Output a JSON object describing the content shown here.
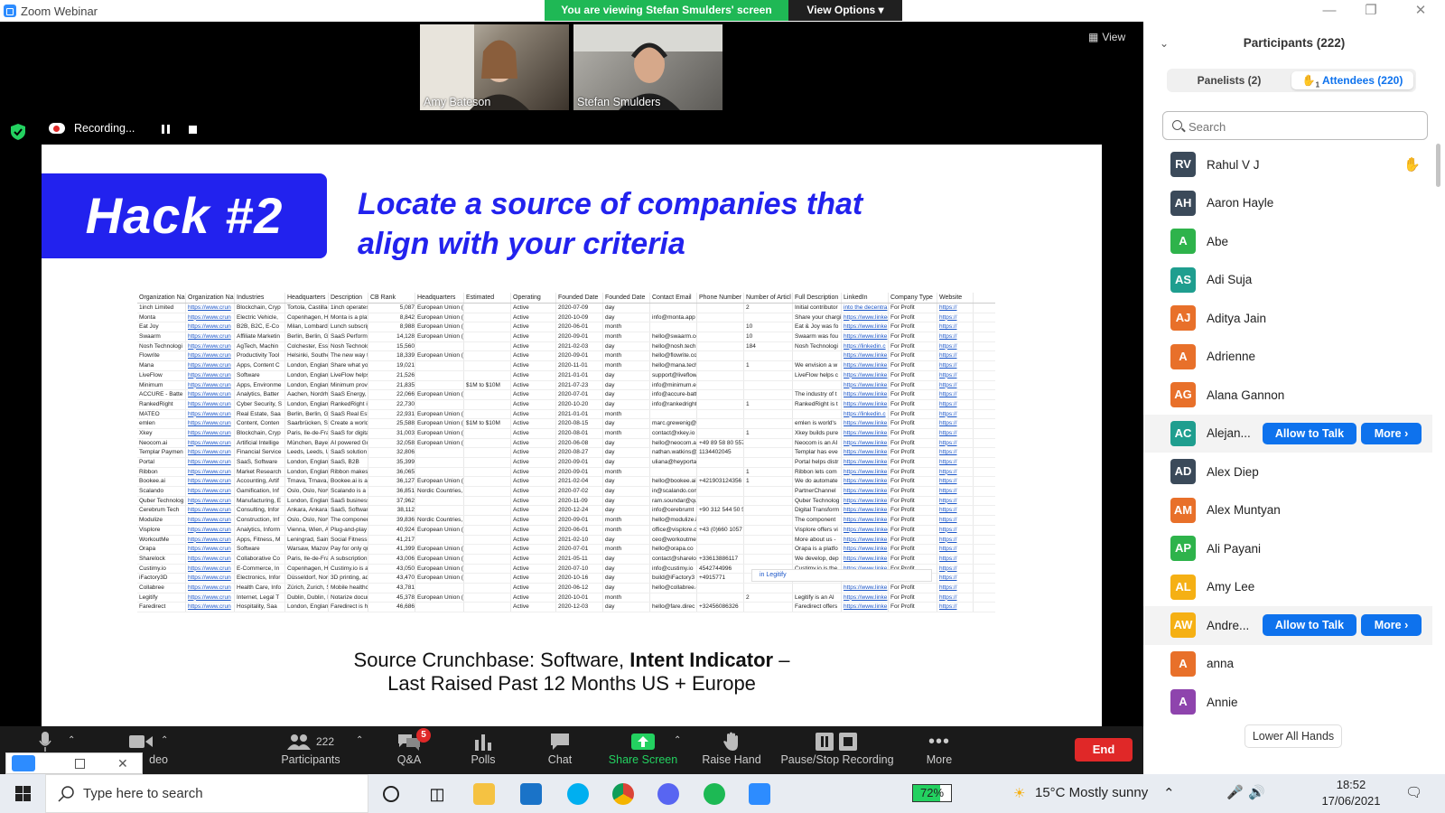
{
  "window": {
    "title": "Zoom Webinar"
  },
  "banner": {
    "viewing": "You are viewing Stefan Smulders' screen",
    "view_options": "View Options"
  },
  "videos": [
    {
      "name": "Amy Bateson"
    },
    {
      "name": "Stefan Smulders"
    }
  ],
  "view_button": "View",
  "recording": {
    "label": "Recording..."
  },
  "slide": {
    "hack_label": "Hack #2",
    "headline_line1": "Locate a source of companies that",
    "headline_line2": "align with your criteria",
    "source_prefix": "Source Crunchbase: Software, ",
    "source_bold": "Intent Indicator",
    "source_suffix": " –",
    "source_line2": "Last Raised Past 12 Months US + Europe"
  },
  "spreadsheet": {
    "headers": [
      "Organization Na",
      "Organization Na",
      "Industries",
      "Headquarters Lo",
      "Description",
      "CB Rank (Comp",
      "Headquarters Re",
      "Estimated Rever",
      "Operating Status",
      "Founded Date",
      "Founded Date P",
      "Contact Email",
      "Phone Number",
      "Number of Articl",
      "Full Description",
      "LinkedIn",
      "Company Type",
      "Website"
    ],
    "rows": [
      [
        "1inch Limited",
        "https://www.crun",
        "Blockchain, Cryp",
        "Tortola, Castilla-",
        "1inch operates a",
        "5,087",
        "European Union (EU)",
        "",
        "Active",
        "2020-07-09",
        "day",
        "",
        "",
        "2",
        "Initial contributor",
        "into the decentra",
        "For Profit",
        "https://"
      ],
      [
        "Monta",
        "https://www.crun",
        "Electric Vehicle,",
        "Copenhagen, He",
        "Monta is a platfo",
        "8,842",
        "European Union (EU), Nordic Cou",
        "",
        "Active",
        "2020-10-09",
        "day",
        "info@monta.app",
        "",
        "",
        "Share your chargi",
        "https://www.linkedin.com/compan",
        "For Profit",
        "https://"
      ],
      [
        "Eat Joy",
        "https://www.crun",
        "B2B, B2C, E-Co",
        "Milan, Lombardi",
        "Lunch subscripti",
        "8,988",
        "European Union (EU)",
        "",
        "Active",
        "2020-06-01",
        "month",
        "",
        "",
        "10",
        "Eat & Joy was fo",
        "https://www.linke",
        "For Profit",
        "https://"
      ],
      [
        "Swaarm",
        "https://www.crun",
        "Affiliate Marketin",
        "Berlin, Berlin, Ge",
        "SaaS Performan",
        "14,128",
        "European Union (EU)",
        "",
        "Active",
        "2020-09-01",
        "month",
        "hello@swaarm.com",
        "",
        "10",
        "Swaarm was fou",
        "https://www.linke",
        "For Profit",
        "https://"
      ],
      [
        "Nosh Technologi",
        "https://www.crun",
        "AgTech, Machin",
        "Colchester, Esse",
        "Nosh Technologi",
        "15,560",
        "",
        "",
        "Active",
        "2021-02-03",
        "day",
        "hello@nosh.tech",
        "",
        "184",
        "Nosh Technologi",
        "https://linkedin.c",
        "For Profit",
        "https://"
      ],
      [
        "Flowrite",
        "https://www.crun",
        "Productivity Tool",
        "Helsinki, Southe",
        "The new way to",
        "18,339",
        "European Union (EU), Nordic Cou",
        "",
        "Active",
        "2020-09-01",
        "month",
        "hello@flowrite.com",
        "",
        "",
        "",
        "https://www.linke",
        "For Profit",
        "https://"
      ],
      [
        "Mana",
        "https://www.crun",
        "Apps, Content C",
        "London, England",
        "Share what you l",
        "19,021",
        "",
        "",
        "Active",
        "2020-11-01",
        "month",
        "hello@mana.tech",
        "",
        "1",
        "We envision a w",
        "https://www.linke",
        "For Profit",
        "https://"
      ],
      [
        "LiveFlow",
        "https://www.crun",
        "Software",
        "London, England",
        "LiveFlow helps c",
        "21,526",
        "",
        "",
        "Active",
        "2021-01-01",
        "day",
        "support@liveflow.io",
        "",
        "",
        "LiveFlow helps c",
        "https://www.linke",
        "For Profit",
        "https://"
      ],
      [
        "Minimum",
        "https://www.crun",
        "Apps, Environme",
        "London, England",
        "Minimum provide",
        "21,835",
        "",
        "$1M to $10M",
        "Active",
        "2021-07-23",
        "day",
        "info@minimum.eco",
        "",
        "",
        "",
        "https://www.linke",
        "For Profit",
        "https://"
      ],
      [
        "ACCURE - Batte",
        "https://www.crun",
        "Analytics, Batter",
        "Aachen, Nordrhe",
        "SaaS Energy, R",
        "22,066",
        "European Union (EU)",
        "",
        "Active",
        "2020-07-01",
        "day",
        "info@accure-batteries.com",
        "",
        "",
        "The industry of t",
        "https://www.linke",
        "For Profit",
        "https://"
      ],
      [
        "RankedRight",
        "https://www.crun",
        "Cyber Security, S",
        "London, England",
        "RankedRight is a",
        "22,730",
        "",
        "",
        "Active",
        "2020-10-20",
        "day",
        "info@rankedright.com",
        "",
        "1",
        "RankedRight is t",
        "https://www.linke",
        "For Profit",
        "https://"
      ],
      [
        "MATEO",
        "https://www.crun",
        "Real Estate, Saa",
        "Berlin, Berlin, Ge",
        "SaaS Real Esta",
        "22,931",
        "European Union (EU)",
        "",
        "Active",
        "2021-01-01",
        "month",
        "",
        "",
        "",
        "",
        "https://linkedin.c",
        "For Profit",
        "https://"
      ],
      [
        "emlen",
        "https://www.crun",
        "Content, Conten",
        "Saarbrücken, Sa",
        "Create a world, v",
        "25,588",
        "European Union (EU)",
        "$1M to $10M",
        "Active",
        "2020-08-15",
        "day",
        "marc.grewenig@emlen.io",
        "",
        "",
        "emlen is world's",
        "https://www.linke",
        "For Profit",
        "https://"
      ],
      [
        "Xkey",
        "https://www.crun",
        "Blockchain, Cryp",
        "Paris, Ile-de-Fran",
        "SaaS for digital s",
        "31,003",
        "European Union (EU)",
        "",
        "Active",
        "2020-08-01",
        "month",
        "contact@xkey.io",
        "",
        "1",
        "Xkey builds pure",
        "https://www.linke",
        "For Profit",
        "https://"
      ],
      [
        "Neocom.ai",
        "https://www.crun",
        "Artificial Intellige",
        "München, Bayer",
        "AI powered Guid",
        "32,058",
        "European Union (EU)",
        "",
        "Active",
        "2020-06-08",
        "day",
        "hello@neocom.ai",
        "+49 89 58 80 557-25",
        "",
        "Neocom is an AI",
        "https://www.linke",
        "For Profit",
        "https://"
      ],
      [
        "Templar Paymen",
        "https://www.crun",
        "Financial Service",
        "Leeds, Leeds, U",
        "SaaS solution for",
        "32,806",
        "",
        "",
        "Active",
        "2020-08-27",
        "day",
        "nathan.watkins@",
        "1134402045",
        "",
        "Templar has eve",
        "https://www.linke",
        "For Profit",
        "https://"
      ],
      [
        "Portal",
        "https://www.crun",
        "SaaS, Software",
        "London, England",
        "SaaS, B2B",
        "35,399",
        "",
        "",
        "Active",
        "2020-09-01",
        "day",
        "uliana@heyportal.io",
        "",
        "",
        "Portal helps distr",
        "https://www.linke",
        "For Profit",
        "https://"
      ],
      [
        "Ribbon",
        "https://www.crun",
        "Market Research",
        "London, England",
        "Ribbon makes it",
        "36,065",
        "",
        "",
        "Active",
        "2020-09-01",
        "month",
        "",
        "",
        "1",
        "Ribbon lets com",
        "https://www.linke",
        "For Profit",
        "https://"
      ],
      [
        "Bookee.ai",
        "https://www.crun",
        "Accounting, Artif",
        "Trnava, Trnava, S",
        "Bookee.ai is a S",
        "36,127",
        "European Union (EU)",
        "",
        "Active",
        "2021-02-04",
        "day",
        "hello@bookee.ai",
        "+421903124356",
        "1",
        "We do automate",
        "https://www.linke",
        "For Profit",
        "https://"
      ],
      [
        "Scalando",
        "https://www.crun",
        "Gamification, Inf",
        "Oslo, Oslo, Norw",
        "Scalando is a Sa",
        "36,851",
        "Nordic Countries, Scandinavia",
        "",
        "Active",
        "2020-07-02",
        "day",
        "in@scalando.com",
        "",
        "",
        "PartnerChannel",
        "https://www.linke",
        "For Profit",
        "https://"
      ],
      [
        "Quber Technolog",
        "https://www.crun",
        "Manufacturing, E",
        "London, England",
        "SaaS business f",
        "37,962",
        "",
        "",
        "Active",
        "2020-11-09",
        "day",
        "ram.soundar@qubertech.com",
        "",
        "",
        "Quber Technolog",
        "https://www.linke",
        "For Profit",
        "https://"
      ],
      [
        "Cerebrum Tech",
        "https://www.crun",
        "Consulting, Infor",
        "Ankara, Ankara,",
        "SaaS, Software,",
        "38,112",
        "",
        "",
        "Active",
        "2020-12-24",
        "day",
        "info@cerebrumt",
        "+90 312 544 50 50",
        "",
        "Digital Transform",
        "https://www.linke",
        "For Profit",
        "https://"
      ],
      [
        "Modulize",
        "https://www.crun",
        "Construction, Inf",
        "Oslo, Oslo, Norw",
        "The component",
        "39,836",
        "Nordic Countries, Scandinavia",
        "",
        "Active",
        "2020-09-01",
        "month",
        "hello@modulize.io",
        "",
        "",
        "The component",
        "https://www.linke",
        "For Profit",
        "https://"
      ],
      [
        "Visplore",
        "https://www.crun",
        "Analytics, Inform",
        "Vienna, Wien, Au",
        "Plug-and-play vi",
        "40,924",
        "European Union (EU)",
        "",
        "Active",
        "2020-06-01",
        "month",
        "office@visplore.c",
        "+43 (0)660 1057 150",
        "",
        "Visplore offers vi",
        "https://www.linkedin.com/compan",
        "For Profit",
        "https://"
      ],
      [
        "WorkoutMe",
        "https://www.crun",
        "Apps, Fitness, M",
        "Leningrad, Saint",
        "Social Fitness M",
        "41,217",
        "",
        "",
        "Active",
        "2021-02-10",
        "day",
        "ceo@workoutme.app",
        "",
        "",
        "More about us -",
        "https://www.linke",
        "For Profit",
        "https://"
      ],
      [
        "Orapa",
        "https://www.crun",
        "Software",
        "Warsaw, Mazow",
        "Pay for only qual",
        "41,399",
        "European Union (EU)",
        "",
        "Active",
        "2020-07-01",
        "month",
        "hello@orapa.co",
        "",
        "",
        "Orapa is a platfo",
        "https://www.linke",
        "For Profit",
        "https://"
      ],
      [
        "Sharelock",
        "https://www.crun",
        "Collaborative Co",
        "Paris, Ile-de-Fran",
        "A subscription ti",
        "43,006",
        "European Union (EU)",
        "",
        "Active",
        "2021-05-11",
        "day",
        "contact@sharelo",
        "+33613886117",
        "",
        "We develop, dep",
        "https://www.linke",
        "For Profit",
        "https://"
      ],
      [
        "Custimy.io",
        "https://www.crun",
        "E-Commerce, In",
        "Copenhagen, He",
        "Custimy.io is a S",
        "43,050",
        "European Union (EU), Nordic Cou",
        "",
        "Active",
        "2020-07-10",
        "day",
        "info@custimy.io",
        "4542744996",
        "",
        "Custimy.io is the",
        "https://www.linke",
        "For Profit",
        "https://"
      ],
      [
        "iFactory3D",
        "https://www.crun",
        "Electronics, Infor",
        "Düsseldorf, Nor",
        "3D printing, add",
        "43,470",
        "European Union (EU)",
        "",
        "Active",
        "2020-10-16",
        "day",
        "build@iFactory3",
        "+4915771",
        "",
        "",
        "https://www.linke",
        "For Profit",
        "https://"
      ],
      [
        "Collabree",
        "https://www.crun",
        "Health Care, Info",
        "Zürich, Zurich, S",
        "Mobile healthcar",
        "43,781",
        "",
        "",
        "Active",
        "2020-06-12",
        "day",
        "hello@collabree.com",
        "",
        "",
        "",
        "https://www.linke",
        "For Profit",
        "https://"
      ],
      [
        "Legitify",
        "https://www.crun",
        "Internet, Legal T",
        "Dublin, Dublin, Ir",
        "Notarize docume",
        "45,378",
        "European Union (EU)",
        "",
        "Active",
        "2020-10-01",
        "month",
        "",
        "",
        "2",
        "Legitify is an AI",
        "https://www.linke",
        "For Profit",
        "https://"
      ],
      [
        "Faredirect",
        "https://www.crun",
        "Hospitality, Saa",
        "London, England",
        "Faredirect is hel",
        "46,686",
        "",
        "",
        "Active",
        "2020-12-03",
        "day",
        "hello@fare.direc",
        "+32456086326",
        "",
        "Faredirect offers",
        "https://www.linke",
        "For Profit",
        "https://"
      ]
    ]
  },
  "sheet_popup": {
    "label": "Legitify"
  },
  "toolbar": {
    "video_label": "deo",
    "participants_label": "Participants",
    "participants_count": "222",
    "qa_label": "Q&A",
    "qa_badge": "5",
    "polls_label": "Polls",
    "chat_label": "Chat",
    "share_label": "Share Screen",
    "raise_label": "Raise Hand",
    "pause_label": "Pause/Stop Recording",
    "more_label": "More",
    "end_label": "End"
  },
  "panel": {
    "title": "Participants (222)",
    "tab_panelists": "Panelists (2)",
    "tab_attendees": "Attendees (220)",
    "raised_count": "1",
    "search_placeholder": "Search",
    "lower_hands": "Lower All Hands",
    "allow_label": "Allow to Talk",
    "more_label": "More",
    "participants": [
      {
        "initials": "RV",
        "name": "Rahul V J",
        "color": "#3b4a5a",
        "hand": true,
        "actions": false
      },
      {
        "initials": "AH",
        "name": "Aaron Hayle",
        "color": "#3b4a5a",
        "hand": false,
        "actions": false
      },
      {
        "initials": "A",
        "name": "Abe",
        "color": "#2eb34b",
        "hand": false,
        "actions": false
      },
      {
        "initials": "AS",
        "name": "Adi Suja",
        "color": "#1f9e8f",
        "hand": false,
        "actions": false
      },
      {
        "initials": "AJ",
        "name": "Aditya Jain",
        "color": "#e8702a",
        "hand": false,
        "actions": false
      },
      {
        "initials": "A",
        "name": "Adrienne",
        "color": "#e8702a",
        "hand": false,
        "actions": false
      },
      {
        "initials": "AG",
        "name": "Alana Gannon",
        "color": "#e8702a",
        "hand": false,
        "actions": false
      },
      {
        "initials": "AC",
        "name": "Alejan...",
        "color": "#1f9e8f",
        "hand": false,
        "actions": true
      },
      {
        "initials": "AD",
        "name": "Alex Diep",
        "color": "#3b4a5a",
        "hand": false,
        "actions": false
      },
      {
        "initials": "AM",
        "name": "Alex Muntyan",
        "color": "#e8702a",
        "hand": false,
        "actions": false
      },
      {
        "initials": "AP",
        "name": "Ali Payani",
        "color": "#2eb34b",
        "hand": false,
        "actions": false
      },
      {
        "initials": "AL",
        "name": "Amy Lee",
        "color": "#f5b014",
        "hand": false,
        "actions": false
      },
      {
        "initials": "AW",
        "name": "Andre...",
        "color": "#f5b014",
        "hand": false,
        "actions": true
      },
      {
        "initials": "A",
        "name": "anna",
        "color": "#e8702a",
        "hand": false,
        "actions": false
      },
      {
        "initials": "A",
        "name": "Annie",
        "color": "#8e44ad",
        "hand": false,
        "actions": false
      }
    ]
  },
  "taskbar": {
    "search_text": "Type here to search",
    "battery": "72%",
    "weather": "15°C  Mostly sunny",
    "time": "18:52",
    "date": "17/06/2021"
  },
  "colors": {
    "accent": "#0e72ed",
    "green": "#23d160",
    "red": "#e02828",
    "slide_blue": "#2222ee"
  }
}
